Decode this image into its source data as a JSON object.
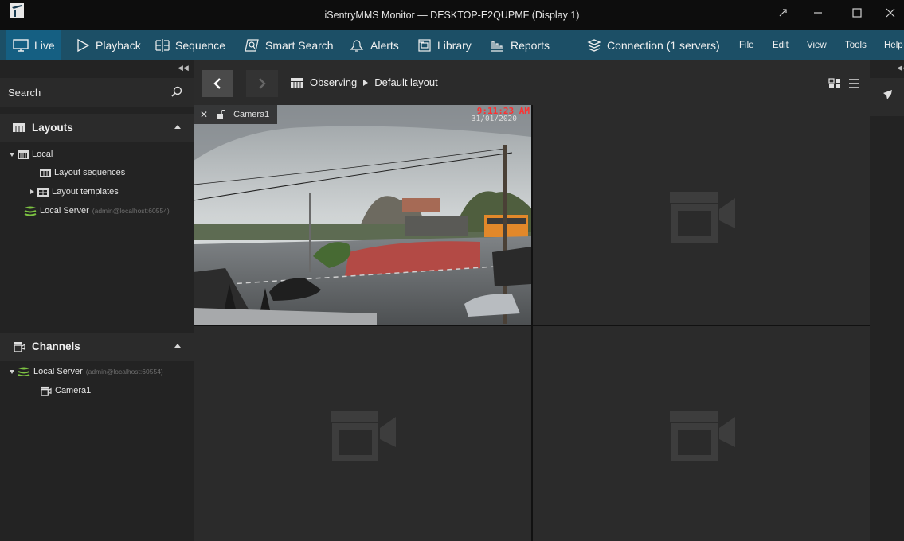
{
  "window": {
    "title": "iSentryMMS Monitor — DESKTOP-E2QUPMF (Display 1)",
    "controls": [
      "restore-icon",
      "minimize-icon",
      "maximize-icon",
      "close-icon"
    ]
  },
  "nav": {
    "items": [
      {
        "label": "Live",
        "icon": "monitor-icon",
        "active": true
      },
      {
        "label": "Playback",
        "icon": "play-icon"
      },
      {
        "label": "Sequence",
        "icon": "sequence-icon"
      },
      {
        "label": "Smart Search",
        "icon": "smart-search-icon"
      },
      {
        "label": "Alerts",
        "icon": "bell-icon"
      },
      {
        "label": "Library",
        "icon": "library-icon"
      },
      {
        "label": "Reports",
        "icon": "reports-icon"
      }
    ],
    "connection": "Connection (1 servers)",
    "menus": [
      "File",
      "Edit",
      "View",
      "Tools",
      "Help"
    ]
  },
  "sidebar": {
    "search_label": "Search",
    "layouts": {
      "title": "Layouts",
      "tree": {
        "local": "Local",
        "layout_sequences": "Layout sequences",
        "layout_templates": "Layout templates",
        "server": "Local Server",
        "server_sub": "(admin@localhost:60554)"
      }
    },
    "channels": {
      "title": "Channels",
      "server": "Local Server",
      "server_sub": "(admin@localhost:60554)",
      "camera": "Camera1"
    }
  },
  "toolbar": {
    "crumb_root": "Observing",
    "crumb_layout": "Default layout"
  },
  "grid": {
    "camera_name": "Camera1",
    "time_overlay": "9:11:23 AM",
    "date_overlay": "31/01/2020"
  },
  "colors": {
    "nav_bar": "#1c4f66",
    "nav_active": "#155f82",
    "server_green": "#7cc242",
    "time_red": "#ff3030"
  }
}
